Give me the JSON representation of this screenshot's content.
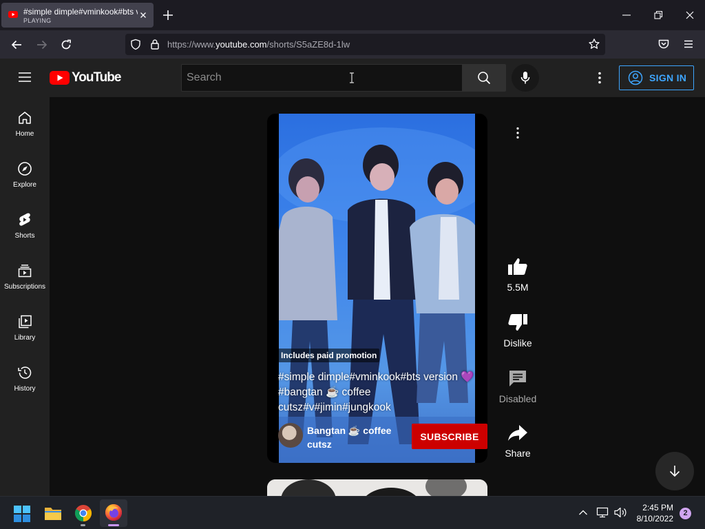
{
  "browser": {
    "tab": {
      "title": "#simple dimple#vminkook#bts version",
      "status": "PLAYING"
    },
    "url": {
      "prefix": "https://www.",
      "domain": "youtube.com",
      "path": "/shorts/S5aZE8d-1lw"
    }
  },
  "youtube": {
    "logo_text": "YouTube",
    "search": {
      "placeholder": "Search"
    },
    "sign_in_label": "SIGN IN",
    "guide": [
      {
        "label": "Home",
        "icon": "home-icon"
      },
      {
        "label": "Explore",
        "icon": "compass-icon"
      },
      {
        "label": "Shorts",
        "icon": "shorts-icon"
      },
      {
        "label": "Subscriptions",
        "icon": "subscriptions-icon"
      },
      {
        "label": "Library",
        "icon": "library-icon"
      },
      {
        "label": "History",
        "icon": "history-icon"
      }
    ],
    "short": {
      "promo_label": "Includes paid promotion",
      "title": "#simple dimple#vminkook#bts version 💜 #bangtan ☕ coffee cutsz#v#jimin#jungkook",
      "channel_name": "Bangtan ☕ coffee cutsz",
      "subscribe_label": "SUBSCRIBE"
    },
    "actions": {
      "like_count": "5.5M",
      "dislike_label": "Dislike",
      "comments_label": "Disabled",
      "share_label": "Share"
    }
  },
  "taskbar": {
    "time": "2:45 PM",
    "date": "8/10/2022",
    "notification_count": "2"
  },
  "colors": {
    "youtube_red": "#ff0000",
    "subscribe_red": "#cc0000",
    "sign_in_blue": "#3ea6ff"
  }
}
